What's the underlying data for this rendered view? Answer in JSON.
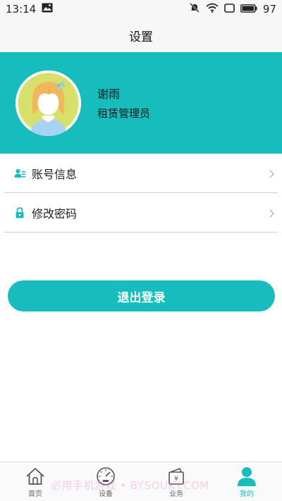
{
  "status_bar": {
    "time": "13:14",
    "battery": "97"
  },
  "header": {
    "title": "设置"
  },
  "profile": {
    "name": "谢雨",
    "role": "租赁管理员"
  },
  "menu": {
    "items": [
      {
        "label": "账号信息",
        "icon": "account-info-icon"
      },
      {
        "label": "修改密码",
        "icon": "lock-icon"
      }
    ]
  },
  "logout": {
    "label": "退出登录"
  },
  "tabs": [
    {
      "label": "首页",
      "icon": "home-icon",
      "active": false
    },
    {
      "label": "设备",
      "icon": "gauge-icon",
      "active": false
    },
    {
      "label": "业务",
      "icon": "wallet-icon",
      "active": false
    },
    {
      "label": "我的",
      "icon": "person-icon",
      "active": true
    }
  ],
  "watermark": "必用手机游戏 • BYSOUKY.COM",
  "colors": {
    "accent": "#17bcbc",
    "header_bg": "#f7f7f7"
  }
}
